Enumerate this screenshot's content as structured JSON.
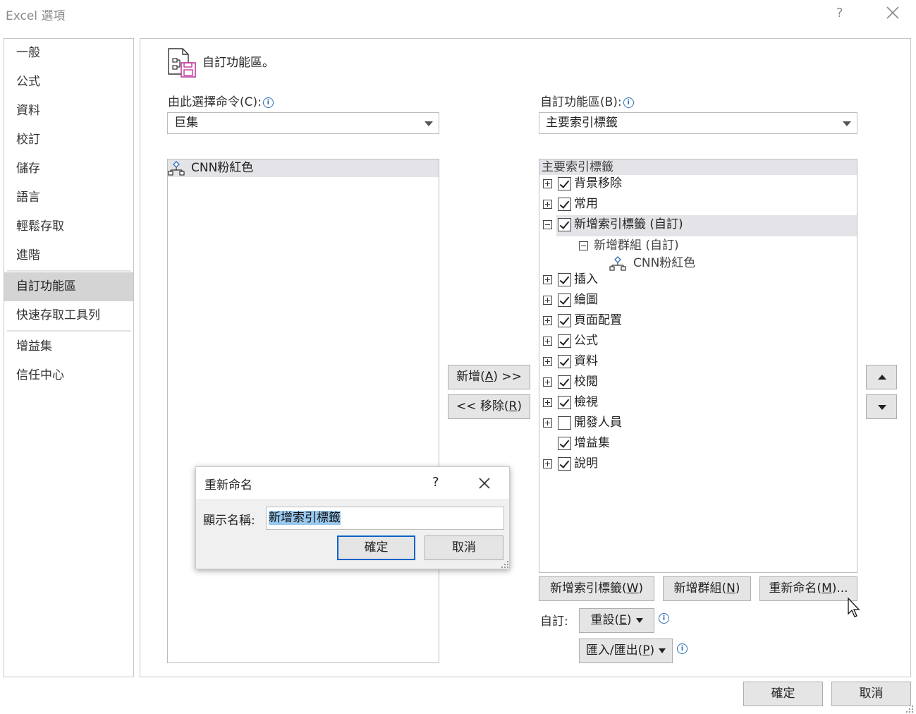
{
  "window": {
    "title": "Excel 選項",
    "help": "?"
  },
  "nav": {
    "items": [
      "一般",
      "公式",
      "資料",
      "校訂",
      "儲存",
      "語言",
      "輕鬆存取",
      "進階",
      "自訂功能區",
      "快速存取工具列",
      "增益集",
      "信任中心"
    ],
    "selected": "自訂功能區"
  },
  "header": {
    "title": "自訂功能區。"
  },
  "left": {
    "label": "由此選擇命令(C):",
    "combo_value": "巨集",
    "list_items": [
      "CNN粉紅色"
    ]
  },
  "right": {
    "label": "自訂功能區(B):",
    "combo_value": "主要索引標籤",
    "tree_header": "主要索引標籤",
    "tree": {
      "r0": "背景移除",
      "r1": "常用",
      "r2": "新增索引標籤 (自訂)",
      "r2_group": "新增群組 (自訂)",
      "r2_item": "CNN粉紅色",
      "r3": "插入",
      "r4": "繪圖",
      "r5": "頁面配置",
      "r6": "公式",
      "r7": "資料",
      "r8": "校閱",
      "r9": "檢視",
      "r10": "開發人員",
      "r11": "增益集",
      "r12": "說明"
    },
    "checked": {
      "r0": true,
      "r1": true,
      "r2": true,
      "r3": true,
      "r4": true,
      "r5": true,
      "r6": true,
      "r7": true,
      "r8": true,
      "r9": true,
      "r10": false,
      "r11": true,
      "r12": true
    }
  },
  "middle": {
    "add_label": "新增(A) >>",
    "remove_label": "<< 移除(R)"
  },
  "bottom": {
    "new_tab": "新增索引標籤(W)",
    "new_group": "新增群組(N)",
    "rename": "重新命名(M)...",
    "customize_label": "自訂:",
    "reset": "重設(E)",
    "import_export": "匯入/匯出(P)"
  },
  "footer": {
    "ok": "確定",
    "cancel": "取消"
  },
  "rename_dialog": {
    "title": "重新命名",
    "help": "?",
    "field_label": "顯示名稱:",
    "field_value": "新增索引標籤",
    "ok": "確定",
    "cancel": "取消"
  },
  "colors": {
    "accent": "#0a64c8",
    "selection": "#99c9ef",
    "nav_selected": "#d4d4d4"
  }
}
